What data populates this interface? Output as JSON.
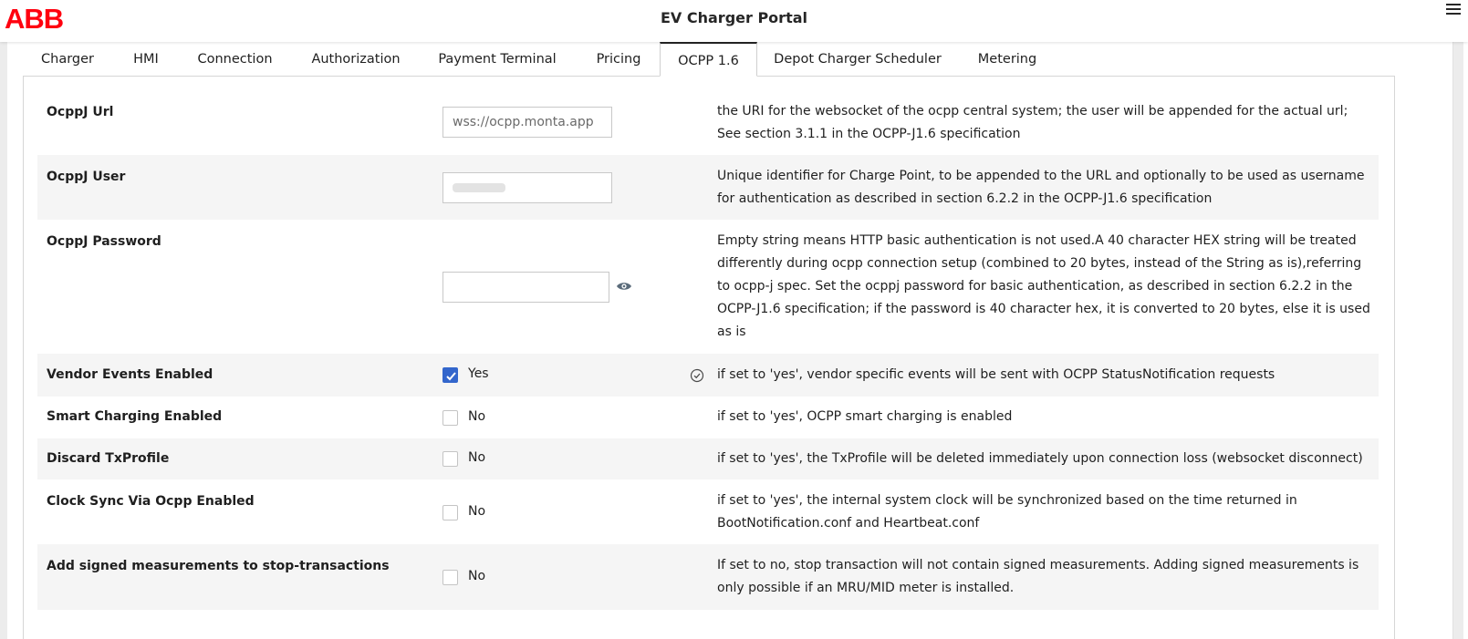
{
  "header": {
    "logo_text": "ABB",
    "title": "EV Charger Portal",
    "menu_icon": "hamburger-menu-icon"
  },
  "tabs": [
    {
      "label": "Charger",
      "active": false
    },
    {
      "label": "HMI",
      "active": false
    },
    {
      "label": "Connection",
      "active": false
    },
    {
      "label": "Authorization",
      "active": false
    },
    {
      "label": "Payment Terminal",
      "active": false
    },
    {
      "label": "Pricing",
      "active": false
    },
    {
      "label": "OCPP 1.6",
      "active": true
    },
    {
      "label": "Depot Charger Scheduler",
      "active": false
    },
    {
      "label": "Metering",
      "active": false
    }
  ],
  "settings": {
    "url": {
      "label": "OcppJ Url",
      "value": "wss://ocpp.monta.app",
      "desc": "the URI for the websocket of the ocpp central system; the user will be appended for the actual url; See section 3.1.1 in the OCPP-J1.6 specification"
    },
    "user": {
      "label": "OcppJ User",
      "desc": "Unique identifier for Charge Point, to be appended to the URL and optionally to be used as username for authentication as described in section 6.2.2 in the OCPP-J1.6 specification"
    },
    "password": {
      "label": "OcppJ Password",
      "value": "",
      "desc": "Empty string means HTTP basic authentication is not used.A 40 character HEX string will be treated differently during ocpp connection setup (combined to 20 bytes, instead of the String as is),referring to ocpp-j spec. Set the ocppj password for basic authentication, as described in section 6.2.2 in the OCPP-J1.6 specification; if the password is 40 character hex, it is converted to 20 bytes, else it is used as is"
    },
    "vendor_events": {
      "label": "Vendor Events Enabled",
      "checked": true,
      "value_label": "Yes",
      "desc": "if set to 'yes', vendor specific events will be sent with OCPP StatusNotification requests"
    },
    "smart_charging": {
      "label": "Smart Charging Enabled",
      "checked": false,
      "value_label": "No",
      "desc": "if set to 'yes', OCPP smart charging is enabled"
    },
    "discard_txprofile": {
      "label": "Discard TxProfile",
      "checked": false,
      "value_label": "No",
      "desc": "if set to 'yes', the TxProfile will be deleted immediately upon connection loss (websocket disconnect)"
    },
    "clock_sync": {
      "label": "Clock Sync Via Ocpp Enabled",
      "checked": false,
      "value_label": "No",
      "desc": "if set to 'yes', the internal system clock will be synchronized based on the time returned in BootNotification.conf and Heartbeat.conf"
    },
    "signed_measurements": {
      "label": "Add signed measurements to stop-transactions",
      "checked": false,
      "value_label": "No",
      "desc": "If set to no, stop transaction will not contain signed measurements. Adding signed measurements is only possible if an MRU/MID meter is installed."
    }
  },
  "colors": {
    "brand_red": "#FF000F",
    "checkbox_blue": "#3366CC"
  }
}
